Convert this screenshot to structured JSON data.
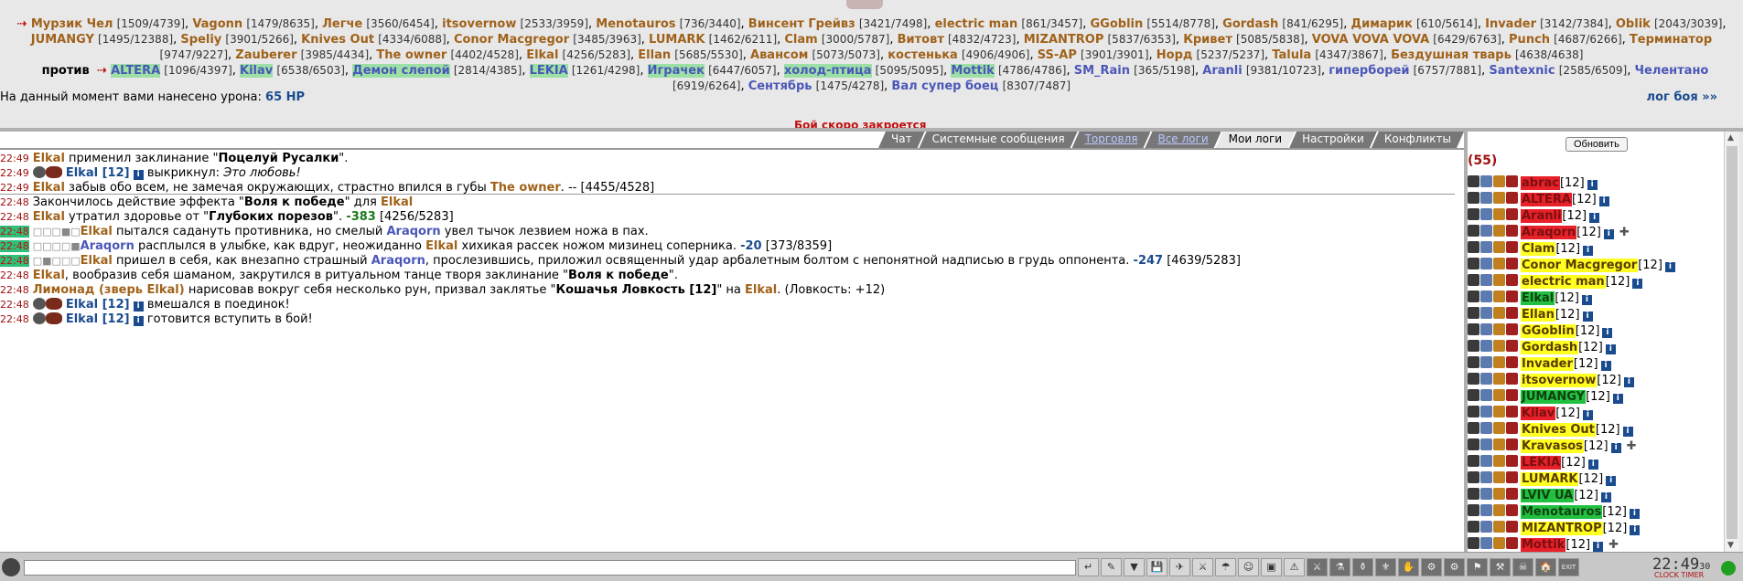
{
  "team1": [
    {
      "name": "Мурзик Чел",
      "hp": "[1509/4739]",
      "arrow": true
    },
    {
      "name": "Vagonn",
      "hp": "[1479/8635]"
    },
    {
      "name": "Легче",
      "hp": "[3560/6454]"
    },
    {
      "name": "itsovernow",
      "hp": "[2533/3959]"
    },
    {
      "name": "Menotauros",
      "hp": "[736/3440]"
    },
    {
      "name": "Винсент Грейвз",
      "hp": "[3421/7498]"
    },
    {
      "name": "electric man",
      "hp": "[861/3457]"
    },
    {
      "name": "GGoblin",
      "hp": "[5514/8778]"
    },
    {
      "name": "Gordash",
      "hp": "[841/6295]"
    },
    {
      "name": "Димарик",
      "hp": "[610/5614]"
    },
    {
      "name": "Invader",
      "hp": "[3142/7384]"
    },
    {
      "name": "Oblik",
      "hp": "[2043/3039]"
    },
    {
      "name": "JUMANGY",
      "hp": "[1495/12388]"
    },
    {
      "name": "Speliy",
      "hp": "[3901/5266]"
    },
    {
      "name": "Knives Out",
      "hp": "[4334/6088]"
    },
    {
      "name": "Conor Macgregor",
      "hp": "[3485/3963]"
    },
    {
      "name": "LUMARK",
      "hp": "[1462/6211]"
    },
    {
      "name": "Clam",
      "hp": "[3000/5787]"
    },
    {
      "name": "Витовт",
      "hp": "[4832/4723]"
    },
    {
      "name": "MIZANTROP",
      "hp": "[5837/6353]"
    },
    {
      "name": "Кривет",
      "hp": "[5085/5838]"
    },
    {
      "name": "VOVA VOVA VOVA",
      "hp": "[6429/6763]"
    },
    {
      "name": "Punch",
      "hp": "[4687/6266]"
    },
    {
      "name": "Терминатор",
      "hp": "[9747/9227]"
    },
    {
      "name": "Zauberer",
      "hp": "[3985/4434]"
    },
    {
      "name": "The owner",
      "hp": "[4402/4528]"
    },
    {
      "name": "Elkal",
      "hp": "[4256/5283]"
    },
    {
      "name": "Ellan",
      "hp": "[5685/5530]"
    },
    {
      "name": "Авансом",
      "hp": "[5073/5073]"
    },
    {
      "name": "костенька",
      "hp": "[4906/4906]"
    },
    {
      "name": "SS-AP",
      "hp": "[3901/3901]"
    },
    {
      "name": "Норд",
      "hp": "[5237/5237]"
    },
    {
      "name": "Talula",
      "hp": "[4347/3867]"
    },
    {
      "name": "Бездушная тварь",
      "hp": "[4638/4638]"
    }
  ],
  "vs_label": "против",
  "team2": [
    {
      "name": "ALTERA",
      "hp": "[1096/4397]",
      "hl": true,
      "arrow": true
    },
    {
      "name": "Kilav",
      "hp": "[6538/6503]",
      "hl": true
    },
    {
      "name": "Демон слепой",
      "hp": "[2814/4385]",
      "hl": true
    },
    {
      "name": "LEKIA",
      "hp": "[1261/4298]",
      "hl": true
    },
    {
      "name": "Игрaчек",
      "hp": "[6447/6057]",
      "hl": true
    },
    {
      "name": "холод-птица",
      "hp": "[5095/5095]",
      "hl": true
    },
    {
      "name": "Mottik",
      "hp": "[4786/4786]",
      "hl": true
    },
    {
      "name": "SM_Rain",
      "hp": "[365/5198]"
    },
    {
      "name": "Aranli",
      "hp": "[9381/10723]"
    },
    {
      "name": "гиперборей",
      "hp": "[6757/7881]"
    },
    {
      "name": "Santexnic",
      "hp": "[2585/6509]"
    },
    {
      "name": "Челентано",
      "hp": "[6919/6264]"
    },
    {
      "name": "Сентябрь",
      "hp": "[1475/4278]"
    },
    {
      "name": "Вал супер боец",
      "hp": "[8307/7487]"
    }
  ],
  "damage": {
    "prefix": "На данный момент вами нанесено урона: ",
    "value": "65",
    "unit": " HP"
  },
  "battle_log_link": "лог боя »»",
  "overlap_text": "Бой скоро закроется",
  "tabs": [
    {
      "label": "Чат",
      "style": ""
    },
    {
      "label": "Системные сообщения",
      "style": ""
    },
    {
      "label": "Торговля",
      "style": "link"
    },
    {
      "label": "Все логи",
      "style": "link"
    },
    {
      "label": "Мои логи",
      "style": "active"
    },
    {
      "label": "Настройки",
      "style": ""
    },
    {
      "label": "Конфликты",
      "style": ""
    }
  ],
  "messages": {
    "m1": {
      "time": "22:49",
      "name": "Elkal",
      "a": " применил заклинание \"",
      "b": "Поцелуй Русалки",
      "c": "\"."
    },
    "m2": {
      "time": "22:49",
      "name": "Elkal [12]",
      "a": " выкрикнул: ",
      "b": "Это любовь!"
    },
    "m3": {
      "time": "22:49",
      "name": "Elkal",
      "a": " забыв обо всем, не замечая окружающих, страстно впился в губы ",
      "b": "The owner",
      "c": ". -- [4455/4528]"
    },
    "m4": {
      "time": "22:48",
      "a": "Закончилось действие эффекта \"",
      "b": "Воля к победе",
      "c": "\" для ",
      "d": "Elkal"
    },
    "m5": {
      "time": "22:48",
      "name": "Elkal",
      "a": " утратил здоровье от \"",
      "b": "Глубоких порезов",
      "c": "\". ",
      "v": "-383",
      "d": " [4256/5283]"
    },
    "m6": {
      "time": "22:48",
      "name": "Elkal",
      "a": " пытался садануть противника, но смелый ",
      "b": "Araqorn",
      "c": " увел тычок лезвием ножа в пах."
    },
    "m7": {
      "time": "22:48",
      "name": "Araqorn",
      "a": " расплылся в улыбке, как вдруг, неожиданно ",
      "b": "Elkal",
      "c": " хихикая рассек ножом мизинец соперника. ",
      "v": "-20",
      "d": " [373/8359]"
    },
    "m8": {
      "time": "22:48",
      "name": "Elkal",
      "a": " пришел в себя, как внезапно страшный ",
      "b": "Araqorn",
      "c": ", прослезившись, приложил освященный удар арбалетным болтом с непонятной надписью в грудь оппонента. ",
      "v": "-247",
      "d": " [4639/5283]"
    },
    "m9": {
      "time": "22:48",
      "name": "Elkal",
      "a": ", вообразив себя шаманом, закрутился в ритуальном танце творя заклинание \"",
      "b": "Воля к победе",
      "c": "\"."
    },
    "m10": {
      "time": "22:48",
      "name": "Лимонад (зверь Elkal)",
      "a": " нарисовав вокруг себя несколько рун, призвал заклятье \"",
      "b": "Кошачья Ловкость [12]",
      "c": "\" на ",
      "d": "Elkal",
      "e": ". (Ловкость: +12)"
    },
    "m11": {
      "time": "22:48",
      "name": "Elkal [12]",
      "a": " вмешался в поединок!"
    },
    "m12": {
      "time": "22:48",
      "name": "Elkal [12]",
      "a": " готовится вступить в бой!"
    }
  },
  "refresh_label": "Обновить",
  "player_count": "(55)",
  "players": [
    {
      "name": "abrac",
      "lvl": "[12]",
      "c": "red"
    },
    {
      "name": "ALTERA",
      "lvl": "[12]",
      "c": "red"
    },
    {
      "name": "Aranli",
      "lvl": "[12]",
      "c": "red"
    },
    {
      "name": "Araqorn",
      "lvl": "[12]",
      "c": "red",
      "plus": true
    },
    {
      "name": "Clam",
      "lvl": "[12]",
      "c": "yel"
    },
    {
      "name": "Conor Macgregor",
      "lvl": "[12]",
      "c": "yel"
    },
    {
      "name": "electric man",
      "lvl": "[12]",
      "c": "yel"
    },
    {
      "name": "Elkal",
      "lvl": "[12]",
      "c": "grn"
    },
    {
      "name": "Ellan",
      "lvl": "[12]",
      "c": "yel"
    },
    {
      "name": "GGoblin",
      "lvl": "[12]",
      "c": "yel"
    },
    {
      "name": "Gordash",
      "lvl": "[12]",
      "c": "yel"
    },
    {
      "name": "Invader",
      "lvl": "[12]",
      "c": "yel"
    },
    {
      "name": "itsovernow",
      "lvl": "[12]",
      "c": "yel"
    },
    {
      "name": "JUMANGY",
      "lvl": "[12]",
      "c": "grn"
    },
    {
      "name": "Kilav",
      "lvl": "[12]",
      "c": "red"
    },
    {
      "name": "Knives Out",
      "lvl": "[12]",
      "c": "yel"
    },
    {
      "name": "Kravasos",
      "lvl": "[12]",
      "c": "yel",
      "plus": true
    },
    {
      "name": "LEKIA",
      "lvl": "[12]",
      "c": "red"
    },
    {
      "name": "LUMARK",
      "lvl": "[12]",
      "c": "yel"
    },
    {
      "name": "LVIV UA",
      "lvl": "[12]",
      "c": "grn"
    },
    {
      "name": "Menotauros",
      "lvl": "[12]",
      "c": "grn"
    },
    {
      "name": "MIZANTROP",
      "lvl": "[12]",
      "c": "yel"
    },
    {
      "name": "Mottik",
      "lvl": "[12]",
      "c": "red",
      "plus": true
    }
  ],
  "info_glyph": "i",
  "plus_glyph": "✚",
  "clock": {
    "time": "22:49",
    "sec": "30",
    "label": "CLOCK TIMER"
  },
  "toolbar_glyphs": [
    "↵",
    "✎",
    "▼",
    "💾",
    "✈",
    "⚔",
    "☂",
    "☺",
    "▣",
    "⚠",
    "⚔",
    "⚗",
    "⚱",
    "⚜",
    "✋",
    "⚙",
    "⚙",
    "⚑",
    "⚒",
    "☠",
    "🏠",
    "EXIT"
  ]
}
